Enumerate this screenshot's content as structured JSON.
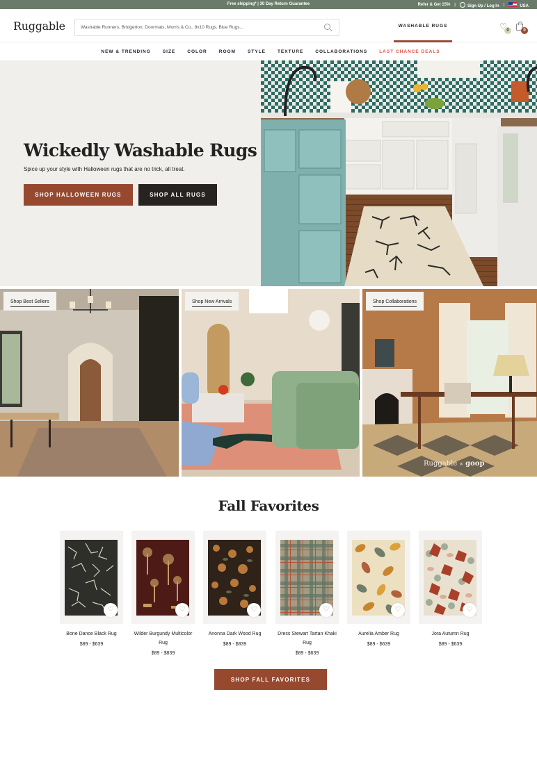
{
  "announcement": {
    "center_text": "Free shipping* | 30 Day Return Guarantee",
    "refer_text": "Refer & Get 15%",
    "account_text": "Sign Up / Log In",
    "region": "USA",
    "separator": "|"
  },
  "header": {
    "logo": "Ruggable",
    "search": {
      "placeholder": "Washable Runners, Bridgerton, Doormats, Morris & Co., 8x10 Rugs, Blue Rugs...",
      "value": ""
    },
    "active_tab": "WASHABLE RUGS",
    "wishlist_count": "0",
    "cart_count": "0"
  },
  "nav": {
    "items": [
      {
        "label": "NEW & TRENDING"
      },
      {
        "label": "SIZE"
      },
      {
        "label": "COLOR"
      },
      {
        "label": "ROOM"
      },
      {
        "label": "STYLE"
      },
      {
        "label": "TEXTURE"
      },
      {
        "label": "COLLABORATIONS"
      },
      {
        "label": "LAST CHANCE DEALS"
      }
    ]
  },
  "hero": {
    "title": "Wickedly Washable Rugs",
    "subtitle": "Spice up your style with Halloween rugs that are no trick, all treat.",
    "primary_button": "SHOP HALLOWEEN RUGS",
    "secondary_button": "SHOP ALL RUGS",
    "image_alt": "Kitchen with skeleton print runner rug"
  },
  "tiles": [
    {
      "label": "Shop Best Sellers"
    },
    {
      "label": "Shop New Arrivals"
    },
    {
      "label": "Shop Collaborations",
      "collab_left": "Ruggable",
      "collab_x": "×",
      "collab_right": "goop"
    }
  ],
  "fall_favorites": {
    "title": "Fall Favorites",
    "products": [
      {
        "name": "Bone Dance Black Rug",
        "price": "$89 - $639"
      },
      {
        "name": "Wilder Burgundy Multicolor Rug",
        "price": "$89 - $839"
      },
      {
        "name": "Anonna Dark Wood Rug",
        "price": "$89 - $839"
      },
      {
        "name": "Dress Stewart Tartan Khaki Rug",
        "price": "$89 - $639"
      },
      {
        "name": "Aurelia Amber Rug",
        "price": "$89 - $639"
      },
      {
        "name": "Jora Autumn Rug",
        "price": "$89 - $639"
      }
    ],
    "button": "SHOP FALL FAVORITES"
  },
  "colors": {
    "brand_rust": "#96492f",
    "announce_green": "#6b7b6b",
    "deal_red": "#e05547",
    "dark_button": "#272321"
  }
}
